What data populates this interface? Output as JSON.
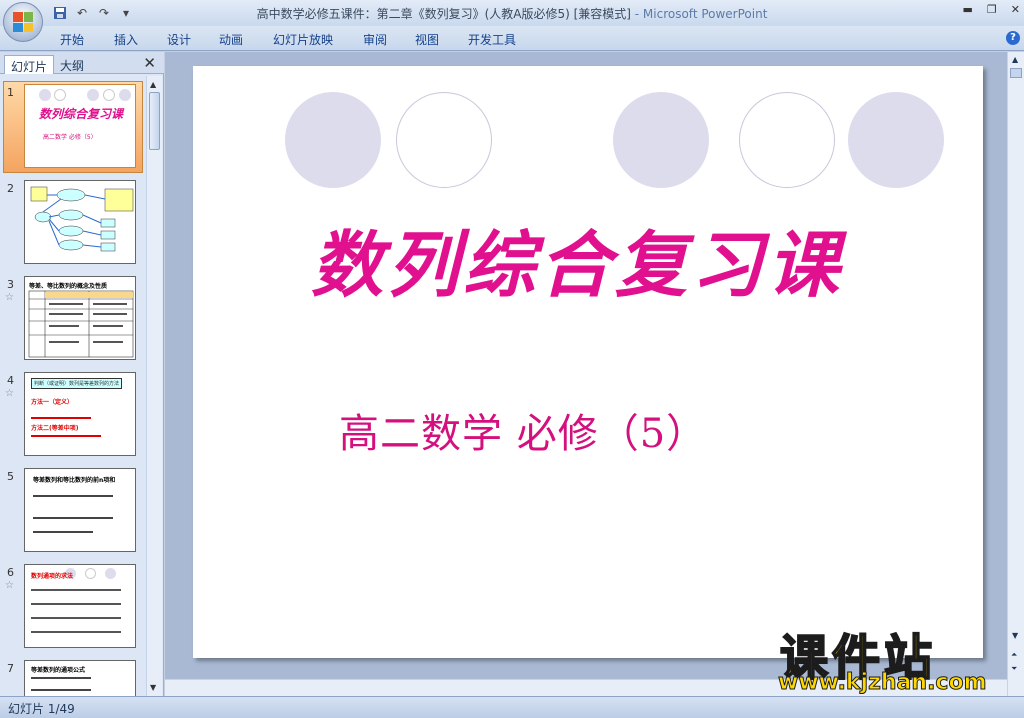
{
  "window": {
    "title": "高中数学必修五课件：第二章《数列复习》(人教A版必修5) [兼容模式]",
    "app": " - Microsoft PowerPoint"
  },
  "qat": {
    "save": "save-icon",
    "undo": "undo-icon",
    "redo": "redo-icon",
    "more": "▾"
  },
  "ribbon": {
    "tabs": [
      "开始",
      "插入",
      "设计",
      "动画",
      "幻灯片放映",
      "审阅",
      "视图",
      "开发工具"
    ]
  },
  "pane": {
    "tab_slides": "幻灯片",
    "tab_outline": "大纲"
  },
  "thumbnails": [
    {
      "num": "1",
      "title": "数列综合复习课",
      "sub": "高二数学 必修（5）"
    },
    {
      "num": "2"
    },
    {
      "num": "3",
      "line": "等差、等比数列的概念及性质"
    },
    {
      "num": "4",
      "box": "判断（或证明）数列是等差数列的方法",
      "a": "方法一（定义）",
      "b": "方法二(等差中项)"
    },
    {
      "num": "5",
      "line": "等差数列和等比数列的前n项和"
    },
    {
      "num": "6",
      "line": "数列通项的求法"
    },
    {
      "num": "7",
      "line": "等差数列的通项公式"
    }
  ],
  "slide": {
    "title": "数列综合复习课",
    "subtitle": "高二数学  必修（5）"
  },
  "status": {
    "text": "幻灯片 1/49"
  },
  "watermark": {
    "big": "课件站",
    "url": "www.kjzhan.com"
  },
  "colors": {
    "accent": "#e0108e",
    "selection": "#f4a460"
  }
}
